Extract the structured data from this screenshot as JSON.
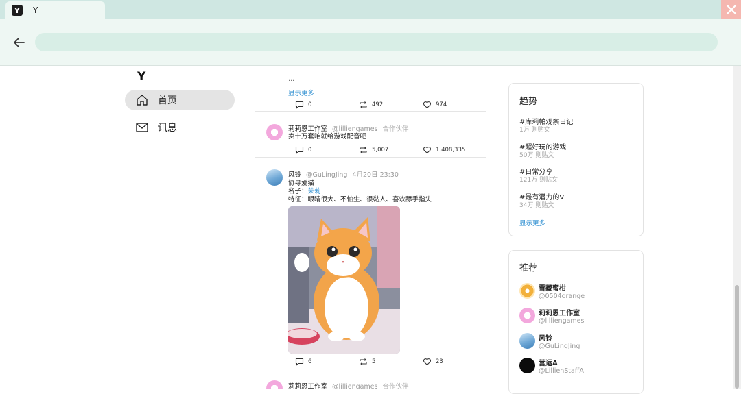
{
  "browser": {
    "tab_title": "Y",
    "tab_icon": "Y",
    "icons": {
      "back": "arrow-left-icon",
      "close": "close-x-icon"
    },
    "colors": {
      "tabbar": "#cfe7e2",
      "close": "#f5b7b0"
    }
  },
  "app": {
    "logo": "Y"
  },
  "nav": [
    {
      "label": "首页",
      "icon": "home-icon",
      "active": true
    },
    {
      "label": "讯息",
      "icon": "mail-icon",
      "active": false
    }
  ],
  "feed": {
    "post0": {
      "truncated": "...",
      "show_more": "显示更多",
      "replies": "0",
      "reposts": "492",
      "likes": "974"
    },
    "post1": {
      "name": "莉莉恩工作室",
      "handle": "@lilliengames",
      "tag": "合作伙伴",
      "text": "卖十万套咱就给游戏配音吧",
      "replies": "0",
      "reposts": "5,007",
      "likes": "1,408,335"
    },
    "post2": {
      "name": "风铃",
      "handle": "@GuLingJing",
      "time": "4月20日 23:30",
      "line1": "协寻爱猫",
      "line2_prefix": "名子：",
      "line2_link": "茉莉",
      "line3": "特征：眼睛很大、不怕生、很黏人、喜欢舔手指头",
      "image": "orange-cat-illustration",
      "replies": "6",
      "reposts": "5",
      "likes": "23"
    },
    "post3": {
      "name": "莉莉恩工作室",
      "handle": "@lilliengames",
      "tag": "合作伙伴"
    }
  },
  "trends": {
    "title": "趋势",
    "items": [
      {
        "name": "#库莉帕观察日记",
        "count": "1万 则贴文"
      },
      {
        "name": "#超好玩的游戏",
        "count": "50万 则贴文"
      },
      {
        "name": "#日常分享",
        "count": "121万 则贴文"
      },
      {
        "name": "#最有潜力的V",
        "count": "34万 则贴文"
      }
    ],
    "show_more": "显示更多"
  },
  "recommend": {
    "title": "推荐",
    "items": [
      {
        "name": "雪藏蜜柑",
        "handle": "@0504orange"
      },
      {
        "name": "莉莉恩工作室",
        "handle": "@lilliengames"
      },
      {
        "name": "风铃",
        "handle": "@GuLingJing"
      },
      {
        "name": "营运A",
        "handle": "@LillienStaffA"
      }
    ]
  }
}
